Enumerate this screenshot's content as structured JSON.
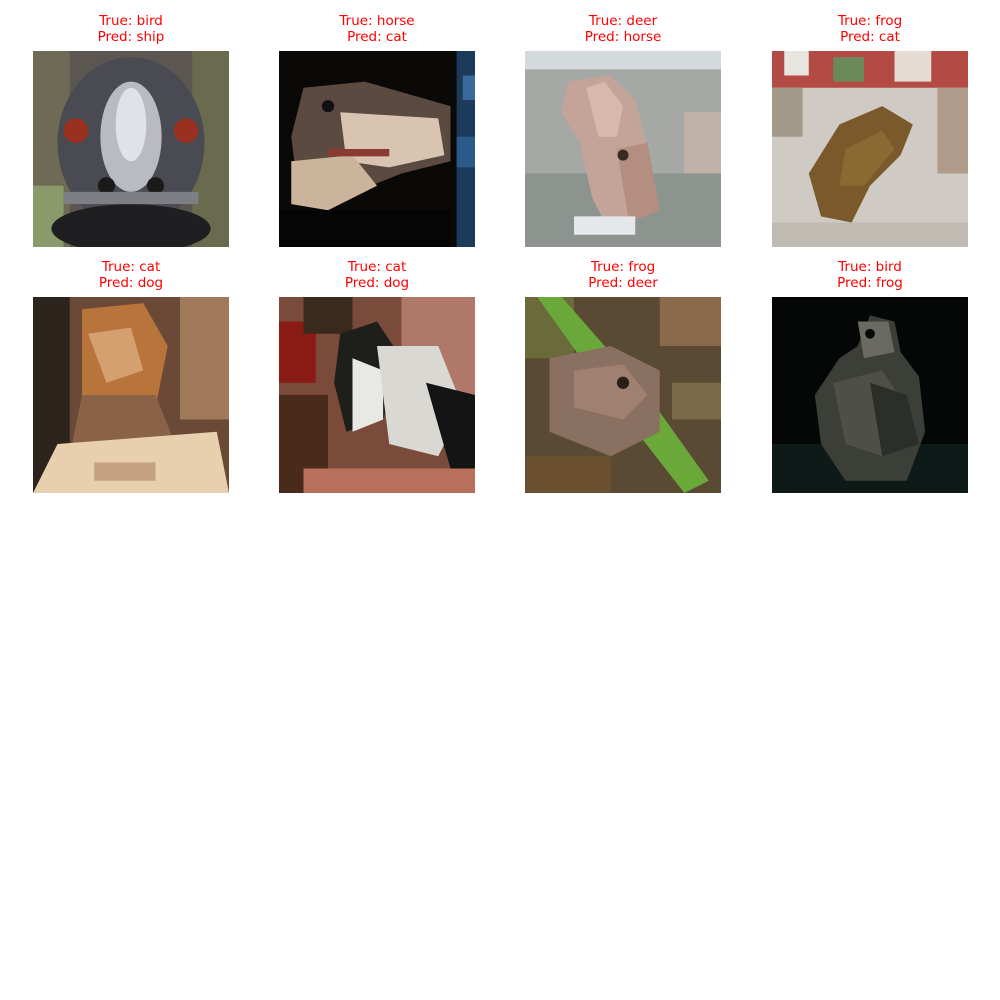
{
  "label_color": "#ff0000",
  "panels": [
    {
      "true_text": "True: bird",
      "pred_text": "Pred: ship",
      "icon": "emu-face-photo"
    },
    {
      "true_text": "True: horse",
      "pred_text": "Pred: cat",
      "icon": "horse-head-photo"
    },
    {
      "true_text": "True: deer",
      "pred_text": "Pred: horse",
      "icon": "deer-photo"
    },
    {
      "true_text": "True: frog",
      "pred_text": "Pred: cat",
      "icon": "frog-photo"
    },
    {
      "true_text": "True: cat",
      "pred_text": "Pred: dog",
      "icon": "cat-photo"
    },
    {
      "true_text": "True: cat",
      "pred_text": "Pred: dog",
      "icon": "cat-photo"
    },
    {
      "true_text": "True: frog",
      "pred_text": "Pred: deer",
      "icon": "frog-photo"
    },
    {
      "true_text": "True: bird",
      "pred_text": "Pred: frog",
      "icon": "bird-photo"
    }
  ]
}
